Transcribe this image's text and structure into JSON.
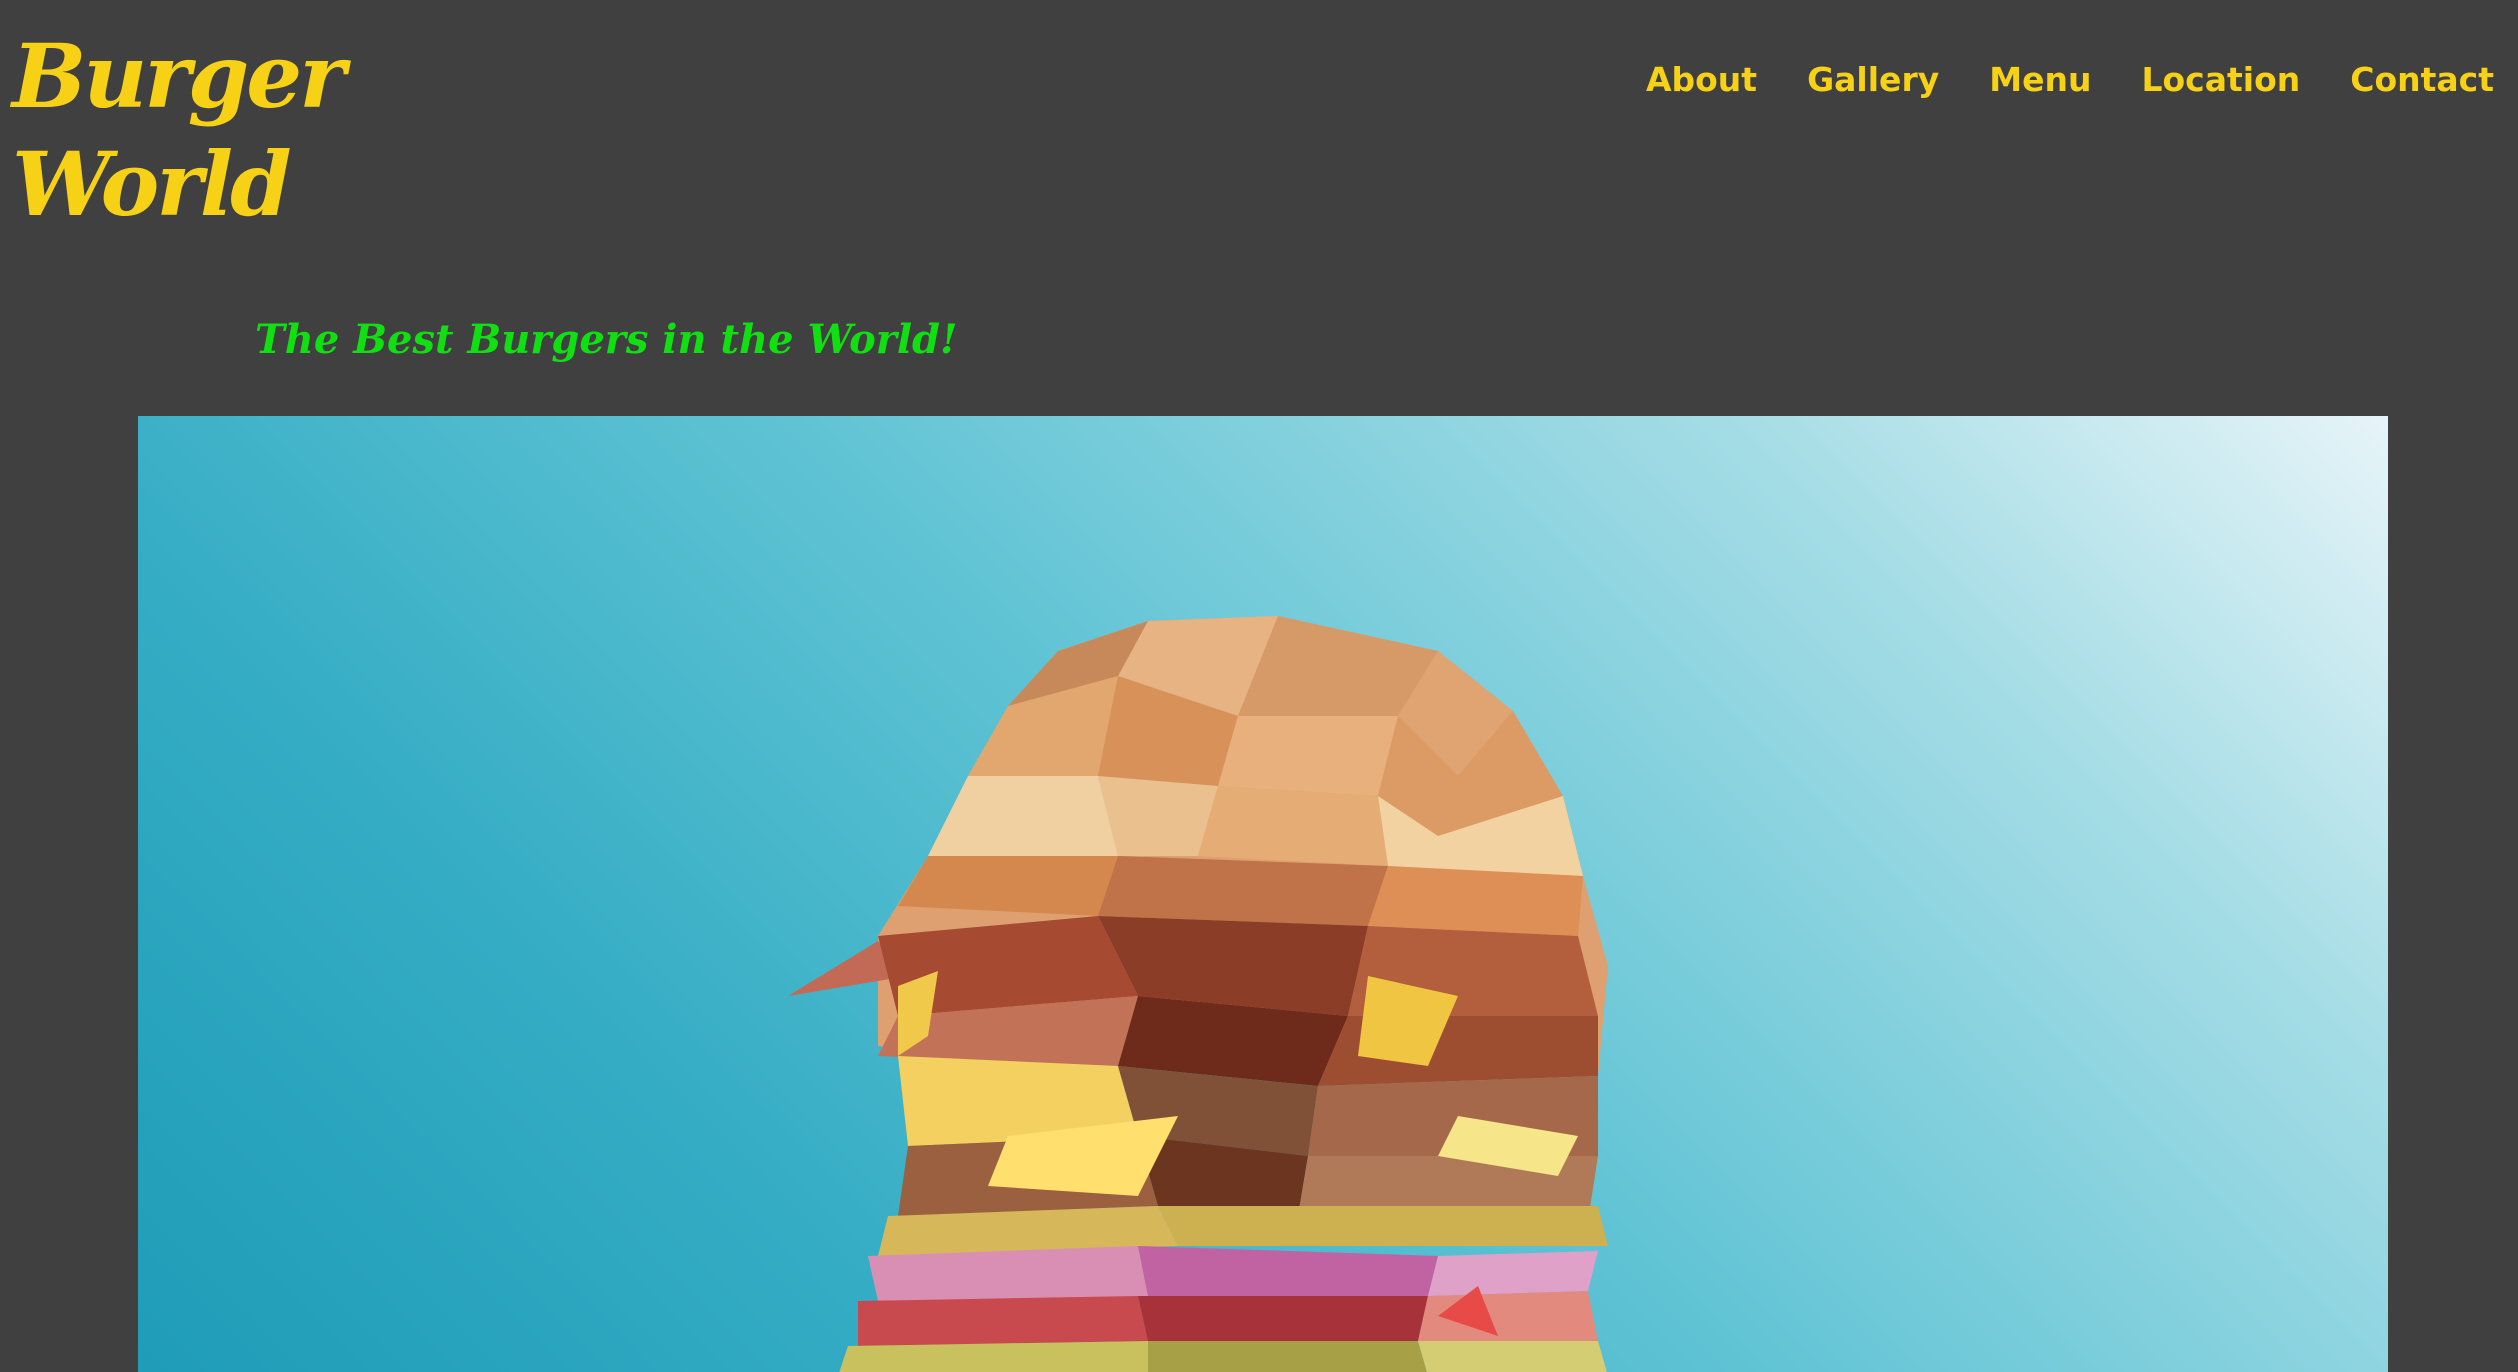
{
  "brand": {
    "line1": "Burger",
    "line2": "World",
    "color": "#f6d116"
  },
  "nav": {
    "items": [
      {
        "label": "About"
      },
      {
        "label": "Gallery"
      },
      {
        "label": "Menu"
      },
      {
        "label": "Location"
      },
      {
        "label": "Contact"
      }
    ]
  },
  "tagline": {
    "text": "The Best Burgers in the World!",
    "color": "#10e012"
  },
  "hero": {
    "image": "low-poly-burger-illustration",
    "background": "#2aa8c2"
  }
}
